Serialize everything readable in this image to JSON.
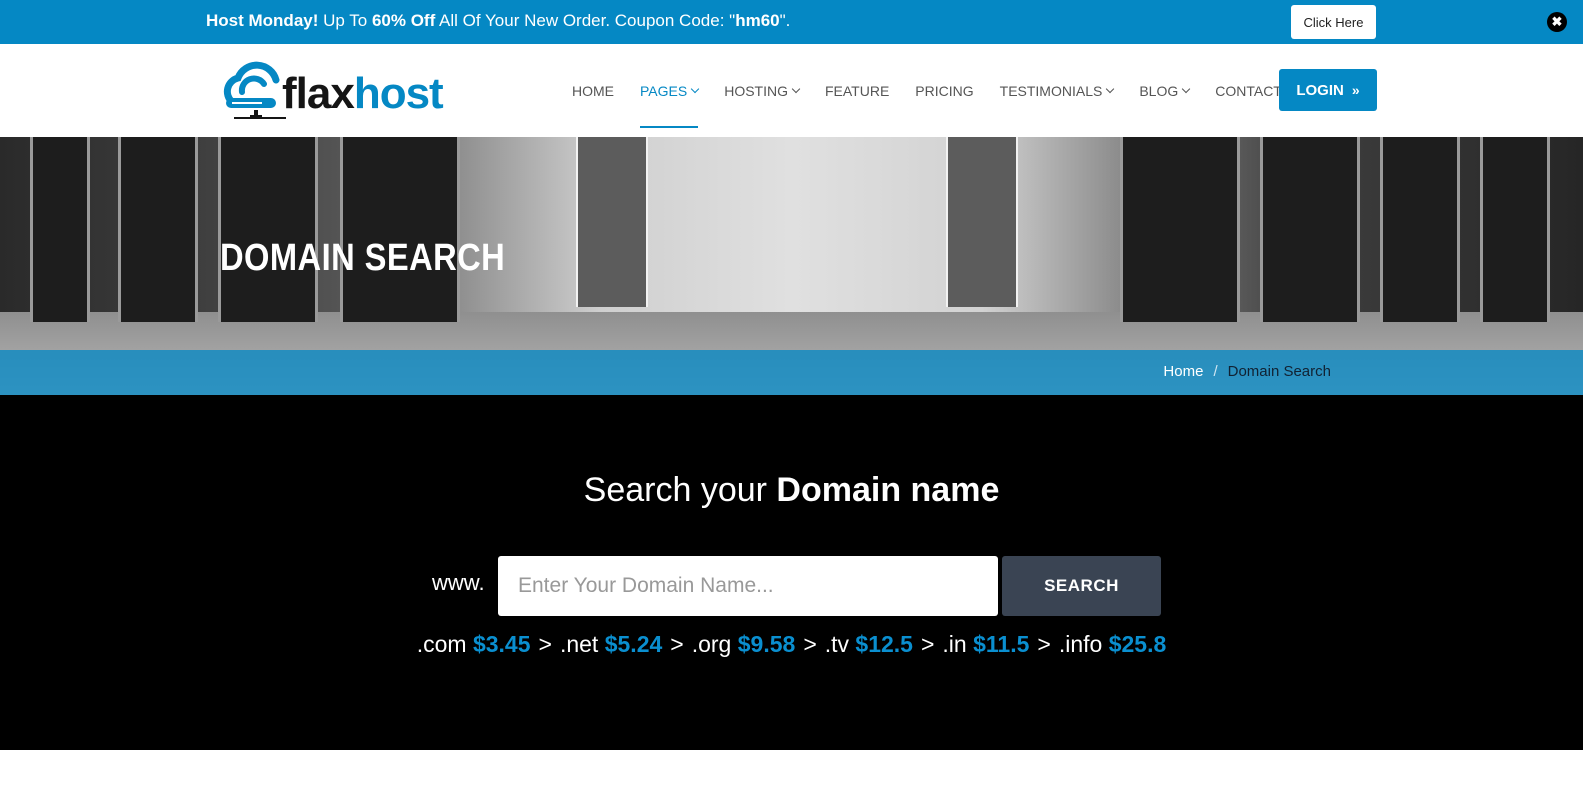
{
  "promo": {
    "lead": "Host Monday!",
    "text_a": " Up To ",
    "discount": "60% Off",
    "text_b": " All Of Your New Order. Coupon Code: \"",
    "code": "hm60",
    "text_c": "\".",
    "button_label": "Click Here",
    "close_glyph": "✖"
  },
  "brand": {
    "part1": "flax",
    "part2": "host"
  },
  "nav": {
    "items": [
      {
        "label": "HOME"
      },
      {
        "label": "PAGES"
      },
      {
        "label": "HOSTING"
      },
      {
        "label": "FEATURE"
      },
      {
        "label": "PRICING"
      },
      {
        "label": "TESTIMONIALS"
      },
      {
        "label": "BLOG"
      },
      {
        "label": "CONTACT"
      }
    ],
    "login_label": "LOGIN",
    "login_arrow": "»"
  },
  "hero": {
    "title": "DOMAIN SEARCH"
  },
  "breadcrumb": {
    "home": "Home",
    "separator": "/",
    "current": "Domain Search"
  },
  "search": {
    "title_light": "Search your ",
    "title_bold": "Domain name",
    "prefix": "www.",
    "placeholder": "Enter Your Domain Name...",
    "button_label": "SEARCH"
  },
  "tlds": [
    {
      "ext": ".com",
      "price": "$3.45"
    },
    {
      "ext": ".net",
      "price": "$5.24"
    },
    {
      "ext": ".org",
      "price": "$9.58"
    },
    {
      "ext": ".tv",
      "price": "$12.5"
    },
    {
      "ext": ".in",
      "price": "$11.5"
    },
    {
      "ext": ".info",
      "price": "$25.8"
    }
  ],
  "colors": {
    "brand": "#0588c4",
    "search_button": "#3a4453"
  }
}
